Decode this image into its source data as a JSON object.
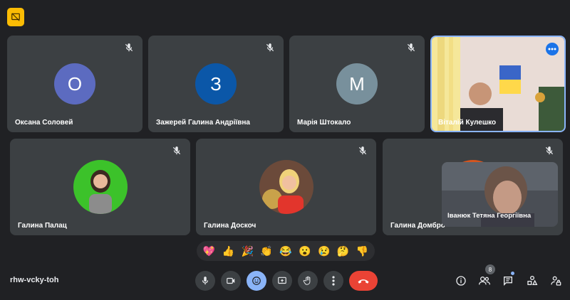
{
  "participants_row1": [
    {
      "name": "Оксана Соловей",
      "initial": "О",
      "color": "#5c6bc0"
    },
    {
      "name": "Зажерей Галина Андріївна",
      "initial": "З",
      "color": "#0b57a8"
    },
    {
      "name": "Марія Штокало",
      "initial": "М",
      "color": "#78909c"
    },
    {
      "name": "Віталій Кулешко"
    }
  ],
  "participants_row2": [
    {
      "name": "Галина Палац"
    },
    {
      "name": "Галина Доскоч"
    },
    {
      "name": "Галина Домбро"
    }
  ],
  "self_view": {
    "name": "Іванюк Тетяна Георгіївна"
  },
  "reactions": [
    "💖",
    "👍",
    "🎉",
    "👏",
    "😂",
    "😮",
    "😢",
    "🤔",
    "👎"
  ],
  "meeting": {
    "code": "rhw-vcky-toh",
    "participant_count": "8"
  },
  "colors": {
    "accent": "#8ab4f8",
    "end_call": "#ea4335",
    "tile_bg": "#3c4043",
    "bg": "#202124"
  }
}
